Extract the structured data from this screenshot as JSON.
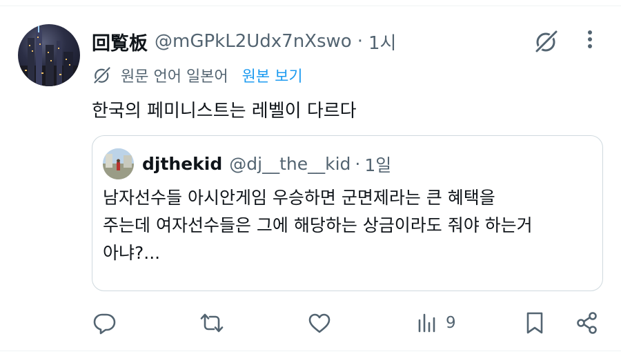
{
  "tweet": {
    "display_name": "回覧板",
    "handle": "@mGPkL2Udx7nXswo",
    "separator": "·",
    "time": "1시",
    "translation": {
      "source_language": "원문 언어 일본어",
      "show_original": "원본 보기"
    },
    "text": "한국의 페미니스트는 레벨이 다르다",
    "avatar_icon": "night-city-avatar",
    "grok_icon": "grok-icon",
    "more_icon": "more-vertical-icon"
  },
  "quote": {
    "display_name": "djthekid",
    "handle": "@dj__the__kid",
    "separator": "·",
    "time": "1일",
    "lines": [
      "남자선수들 아시안게임 우승하면 군면제라는 큰 혜택을",
      "주는데 여자선수들은 그에 해당하는 상금이라도 줘야 하는거",
      "아냐?..."
    ]
  },
  "actions": {
    "reply_icon": "reply-icon",
    "retweet_icon": "retweet-icon",
    "like_icon": "heart-icon",
    "views_icon": "views-icon",
    "views_count": "9",
    "bookmark_icon": "bookmark-icon",
    "share_icon": "share-icon"
  },
  "colors": {
    "text_primary": "#0f1419",
    "text_secondary": "#536471",
    "link": "#1d9bf0",
    "border": "#cfd9de"
  }
}
